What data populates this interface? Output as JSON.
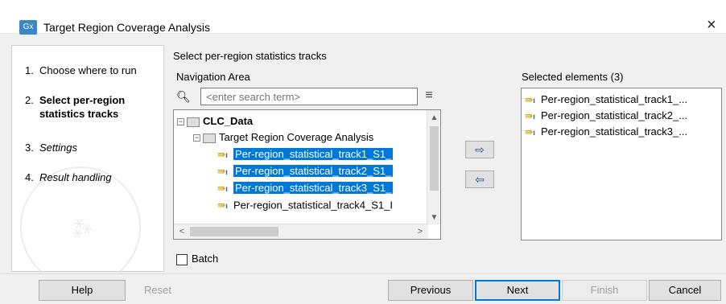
{
  "window": {
    "app_icon": "Gx",
    "title": "Target Region Coverage Analysis",
    "close_glyph": "×"
  },
  "steps": [
    {
      "number": "1.",
      "label": "Choose where to run",
      "style": "normal"
    },
    {
      "number": "2.",
      "label": "Select per-region statistics tracks",
      "style": "bold"
    },
    {
      "number": "3.",
      "label": "Settings",
      "style": "italic"
    },
    {
      "number": "4.",
      "label": "Result handling",
      "style": "italic"
    }
  ],
  "main": {
    "section_title": "Select per-region statistics tracks",
    "navigation_area_label": "Navigation Area",
    "search": {
      "placeholder": "<enter search term>",
      "value": ""
    },
    "tree": [
      {
        "label": "CLC_Data",
        "level": 0,
        "type": "root",
        "expanded": true,
        "selected": false
      },
      {
        "label": "Target Region Coverage Analysis",
        "level": 1,
        "type": "folder",
        "expanded": true,
        "selected": false
      },
      {
        "label": "Per-region_statistical_track1_S1_",
        "level": 2,
        "type": "track",
        "selected": true
      },
      {
        "label": "Per-region_statistical_track2_S1_",
        "level": 2,
        "type": "track",
        "selected": true
      },
      {
        "label": "Per-region_statistical_track3_S1_",
        "level": 2,
        "type": "track",
        "selected": true
      },
      {
        "label": "Per-region_statistical_track4_S1_I",
        "level": 2,
        "type": "track",
        "selected": false
      }
    ],
    "add_arrow": "⇨",
    "remove_arrow": "⇦",
    "selected_elements_label": "Selected elements (3)",
    "selected_elements": [
      "Per-region_statistical_track1_...",
      "Per-region_statistical_track2_...",
      "Per-region_statistical_track3_..."
    ],
    "batch_label": "Batch",
    "batch_checked": false
  },
  "footer": {
    "help": "Help",
    "reset": "Reset",
    "previous": "Previous",
    "next": "Next",
    "finish": "Finish",
    "cancel": "Cancel"
  },
  "colors": {
    "selection": "#0078d7",
    "track_icon_yellow": "#c9a300",
    "track_icon_blue": "#2b63b8"
  }
}
